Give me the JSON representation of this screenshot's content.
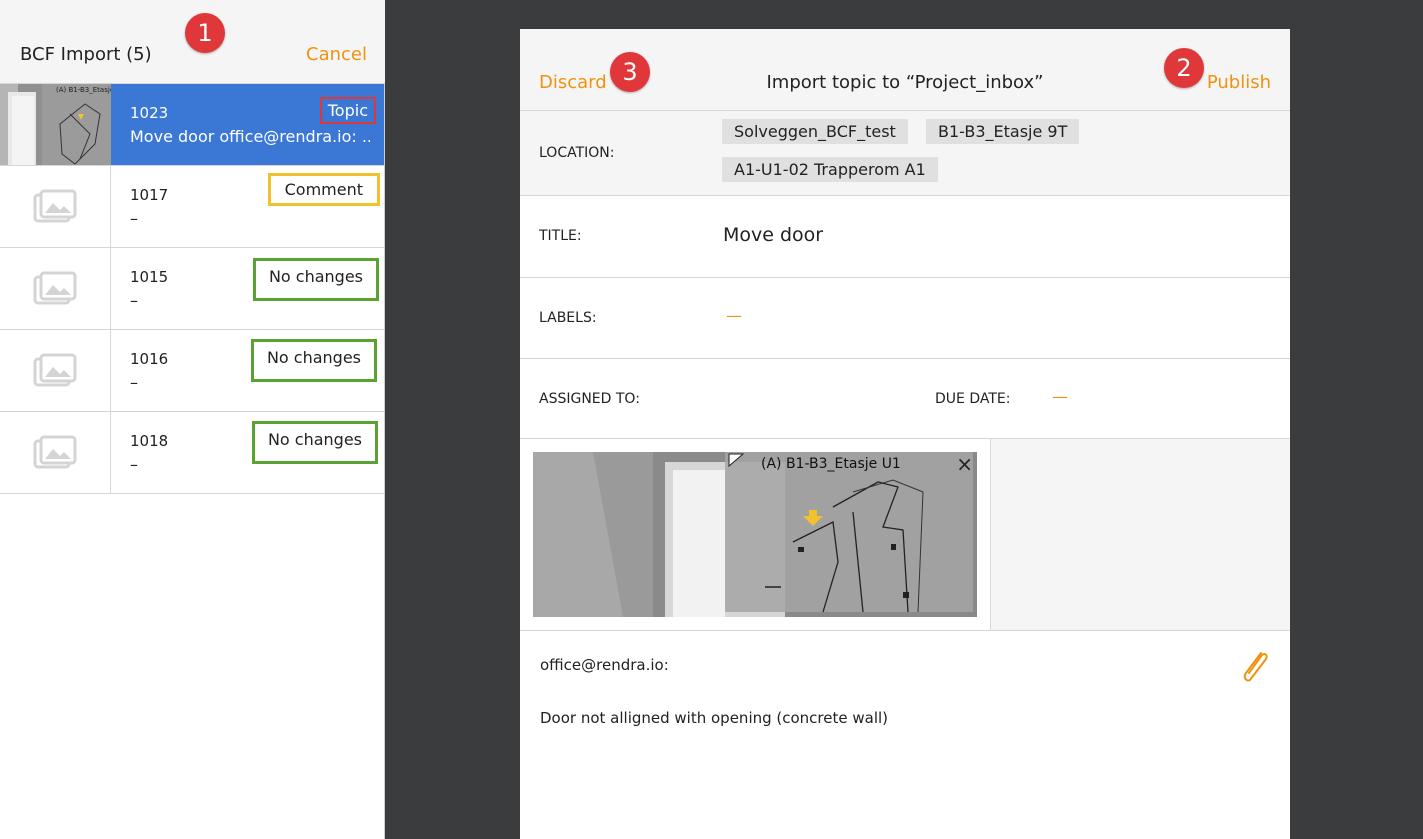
{
  "left_panel": {
    "title": "BCF Import (5)",
    "cancel_label": "Cancel",
    "callout": "1",
    "items": [
      {
        "id": "1023",
        "subtitle": "Move door office@rendra.io: ...",
        "tag": "Topic",
        "tag_color": "#e0373a",
        "selected": true,
        "thumb_caption": "(A) B1-B3_Etasje"
      },
      {
        "id": "1017",
        "subtitle": "–",
        "tag": "Comment",
        "tag_color": "#f2c12e",
        "selected": false
      },
      {
        "id": "1015",
        "subtitle": "–",
        "tag": "No changes",
        "tag_color": "#5aa233",
        "selected": false
      },
      {
        "id": "1016",
        "subtitle": "–",
        "tag": "No changes",
        "tag_color": "#5aa233",
        "selected": false
      },
      {
        "id": "1018",
        "subtitle": "–",
        "tag": "No changes",
        "tag_color": "#5aa233",
        "selected": false
      }
    ]
  },
  "dialog": {
    "discard_label": "Discard",
    "discard_callout": "3",
    "title": "Import topic to “Project_inbox”",
    "publish_label": "Publish",
    "publish_callout": "2",
    "location": {
      "label": "LOCATION:",
      "chips": [
        "Solveggen_BCF_test",
        "B1-B3_Etasje 9T",
        "A1-U1-02 Trapperom A1"
      ]
    },
    "title_field": {
      "label": "TITLE:",
      "value": "Move door"
    },
    "labels_field": {
      "label": "LABELS:",
      "value": "—"
    },
    "assigned_to": {
      "label": "ASSIGNED TO:",
      "value": ""
    },
    "due_date": {
      "label": "DUE DATE:",
      "value": "—"
    },
    "snapshot": {
      "caption": "(A) B1-B3_Etasje U1",
      "close_icon": "×"
    },
    "comment": {
      "author": "office@rendra.io:",
      "text": "Door not alligned with opening (concrete wall)"
    }
  },
  "colors": {
    "accent": "#f0920f",
    "selected_bg": "#3b78d6",
    "callout_red": "#e0373a",
    "background_dark": "#3b3c3d"
  },
  "icons": [
    "image-placeholder-icon",
    "close-icon",
    "paperclip-icon"
  ]
}
